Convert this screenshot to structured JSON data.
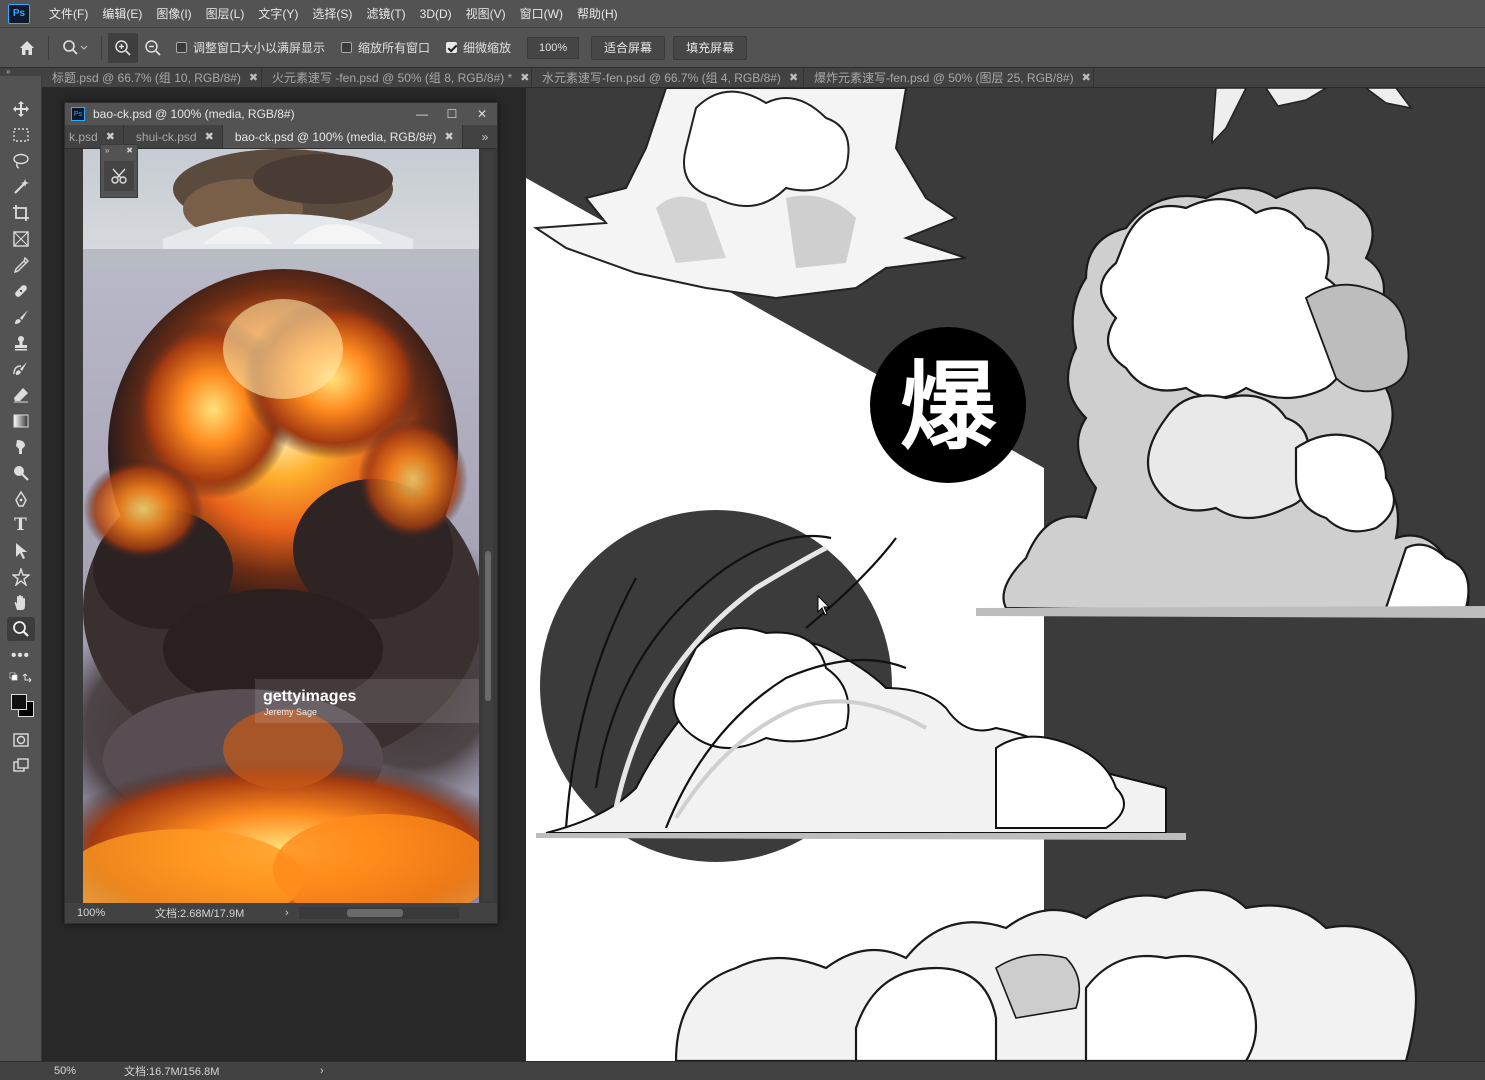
{
  "app": {
    "logo": "Ps"
  },
  "menu": [
    "文件(F)",
    "编辑(E)",
    "图像(I)",
    "图层(L)",
    "文字(Y)",
    "选择(S)",
    "滤镜(T)",
    "3D(D)",
    "视图(V)",
    "窗口(W)",
    "帮助(H)"
  ],
  "options": {
    "resize_windows_label": "调整窗口大小以满屏显示",
    "zoom_all_label": "缩放所有窗口",
    "scrubby_zoom_label": "细微缩放",
    "zoom_value": "100%",
    "fit_screen_label": "适合屏幕",
    "fill_screen_label": "填充屏幕"
  },
  "tabs": [
    {
      "label": "标题.psd @ 66.7% (组 10, RGB/8#)"
    },
    {
      "label": "火元素速写 -fen.psd @ 50% (组 8, RGB/8#) *"
    },
    {
      "label": "水元素速写-fen.psd @ 66.7% (组 4, RGB/8#)"
    },
    {
      "label": "爆炸元素速写-fen.psd @ 50% (图层 25, RGB/8#)"
    }
  ],
  "float_window": {
    "title": "bao-ck.psd @ 100% (media, RGB/8#)",
    "tabs": [
      {
        "label": "k.psd"
      },
      {
        "label": "shui-ck.psd"
      },
      {
        "label": "bao-ck.psd @ 100% (media, RGB/8#)"
      }
    ],
    "zoom": "100%",
    "doc_size": "文档:2.68M/17.9M",
    "watermark": "gettyimages",
    "watermark_sub": "Jeremy Sage"
  },
  "canvas": {
    "character": "爆"
  },
  "status": {
    "zoom": "50%",
    "doc_size": "文档:16.7M/156.8M"
  },
  "colors": {
    "accent": "#31a8ff",
    "chrome": "#535353",
    "tabbar": "#424242",
    "workspace": "#282828"
  }
}
